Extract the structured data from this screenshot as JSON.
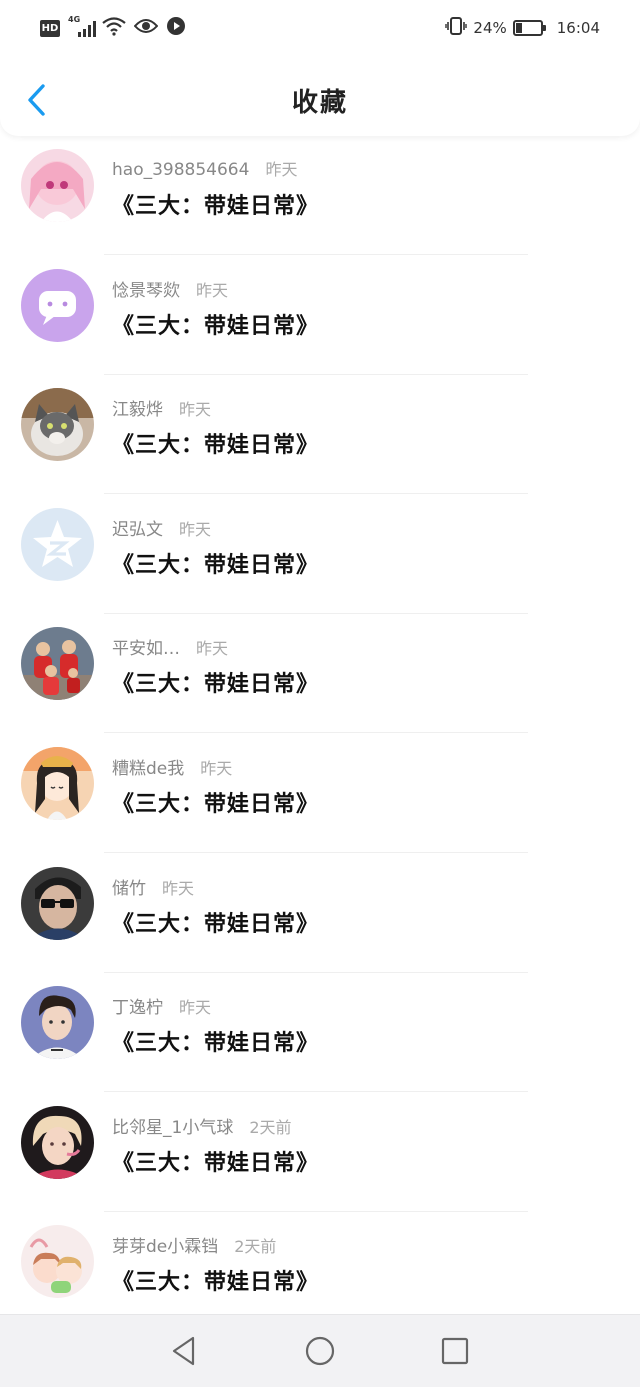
{
  "status_bar": {
    "left_icons": [
      "hd-badge",
      "4g-signal-icon",
      "wifi-icon",
      "eye-icon",
      "play-icon"
    ],
    "network_label": "4G",
    "hd_label": "HD",
    "battery_percent": "24%",
    "battery_level": 0.24,
    "time": "16:04"
  },
  "header": {
    "back_icon": "chevron-left-icon",
    "title": "收藏"
  },
  "favorites": [
    {
      "user": "hao_398854664",
      "time": "昨天",
      "title": "《三大：带娃日常》",
      "avatar": "anime-girl-pink"
    },
    {
      "user": "惗景琴欻",
      "time": "昨天",
      "title": "《三大：带娃日常》",
      "avatar": "purple-chat-bubble"
    },
    {
      "user": "江毅烨",
      "time": "昨天",
      "title": "《三大：带娃日常》",
      "avatar": "cat-photo"
    },
    {
      "user": "迟弘文",
      "time": "昨天",
      "title": "《三大：带娃日常》",
      "avatar": "qq-zone-star"
    },
    {
      "user": "平安如…",
      "time": "昨天",
      "title": "《三大：带娃日常》",
      "avatar": "family-red-clothes"
    },
    {
      "user": "糟糕de我",
      "time": "昨天",
      "title": "《三大：带娃日常》",
      "avatar": "cartoon-girl"
    },
    {
      "user": "储竹",
      "time": "昨天",
      "title": "《三大：带娃日常》",
      "avatar": "man-sunglasses"
    },
    {
      "user": "丁逸柠",
      "time": "昨天",
      "title": "《三大：带娃日常》",
      "avatar": "young-man-portrait"
    },
    {
      "user": "比邻星_1小气球",
      "time": "2天前",
      "title": "《三大：带娃日常》",
      "avatar": "blonde-person"
    },
    {
      "user": "芽芽de小霖铛",
      "time": "2天前",
      "title": "《三大：带娃日常》",
      "avatar": "cartoon-couple"
    }
  ],
  "system_nav": {
    "back_icon": "triangle-back-icon",
    "home_icon": "circle-home-icon",
    "recents_icon": "square-recents-icon"
  },
  "colors": {
    "accent": "#1a9bf0",
    "text_primary": "#111111",
    "text_secondary": "#888888"
  }
}
